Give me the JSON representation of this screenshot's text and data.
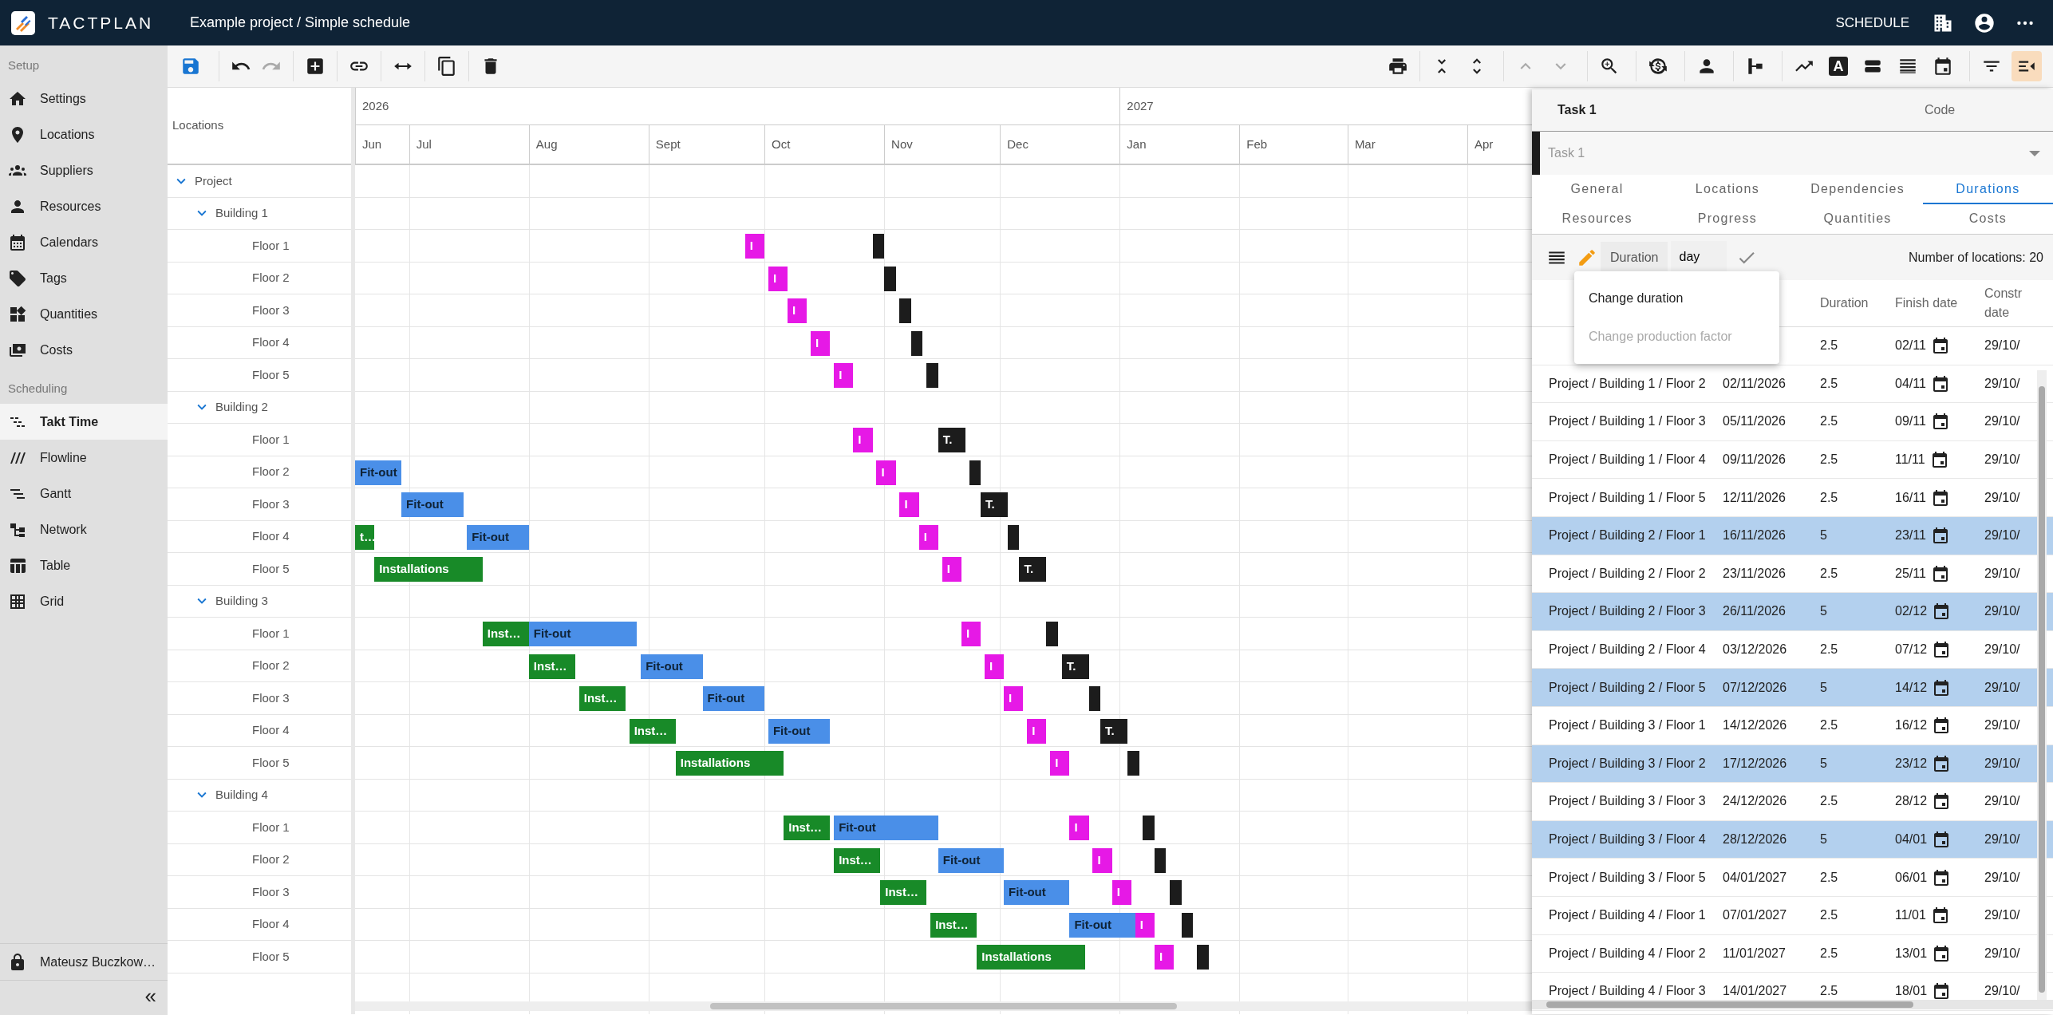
{
  "app": {
    "logo": "TACTPLAN",
    "breadcrumb": "Example project / Simple schedule",
    "mode": "SCHEDULE"
  },
  "sidebar": {
    "sections": [
      {
        "title": "Setup",
        "items": [
          {
            "label": "Settings",
            "selected": false
          },
          {
            "label": "Locations",
            "selected": false
          },
          {
            "label": "Suppliers",
            "selected": false
          },
          {
            "label": "Resources",
            "selected": false
          },
          {
            "label": "Calendars",
            "selected": false
          },
          {
            "label": "Tags",
            "selected": false
          },
          {
            "label": "Quantities",
            "selected": false
          },
          {
            "label": "Costs",
            "selected": false
          }
        ]
      },
      {
        "title": "Scheduling",
        "items": [
          {
            "label": "Takt Time",
            "selected": true
          },
          {
            "label": "Flowline",
            "selected": false
          },
          {
            "label": "Gantt",
            "selected": false
          },
          {
            "label": "Network",
            "selected": false
          },
          {
            "label": "Table",
            "selected": false
          },
          {
            "label": "Grid",
            "selected": false
          }
        ]
      }
    ],
    "user": "Mateusz Buczkow…",
    "collapse": "«"
  },
  "toolbar": {
    "left": [
      {
        "disabled": false
      },
      {
        "disabled": false
      },
      {
        "disabled": true
      },
      {
        "disabled": false
      },
      {
        "disabled": false
      },
      {
        "disabled": false
      },
      {
        "disabled": false
      },
      {
        "disabled": false
      }
    ],
    "right": [
      {
        "disabled": false,
        "selected": false
      },
      {
        "disabled": false,
        "selected": false
      },
      {
        "disabled": false,
        "selected": false
      },
      {
        "disabled": true,
        "selected": false
      },
      {
        "disabled": true,
        "selected": false
      },
      {
        "disabled": false,
        "selected": false
      },
      {
        "disabled": false,
        "selected": false
      },
      {
        "disabled": false,
        "selected": false
      },
      {
        "disabled": false,
        "selected": false
      },
      {
        "disabled": false,
        "selected": false
      },
      {
        "disabled": false,
        "selected": false,
        "label": "A"
      },
      {
        "disabled": false,
        "selected": false
      },
      {
        "disabled": false,
        "selected": false
      },
      {
        "disabled": false,
        "selected": false
      },
      {
        "disabled": false,
        "selected": false
      },
      {
        "disabled": false,
        "selected": true
      }
    ]
  },
  "gantt": {
    "header": "Locations",
    "years": [
      "2026",
      "2027"
    ],
    "months": [
      "Jun",
      "Jul",
      "Aug",
      "Sept",
      "Oct",
      "Nov",
      "Dec",
      "Jan",
      "Feb",
      "Mar",
      "Apr"
    ],
    "locations": [
      {
        "label": "Project",
        "expanded": true,
        "children": [
          {
            "label": "Building 1",
            "expanded": true,
            "children": [
              {
                "label": "Floor 1",
                "bars": [
                  {
                    "label": "I",
                    "color": "#e619e6"
                  },
                  {
                    "color": "#1c1c1c"
                  }
                ]
              },
              {
                "label": "Floor 2",
                "bars": [
                  {
                    "label": "I",
                    "color": "#e619e6"
                  },
                  {
                    "color": "#1c1c1c"
                  }
                ]
              },
              {
                "label": "Floor 3",
                "bars": [
                  {
                    "label": "I",
                    "color": "#e619e6"
                  },
                  {
                    "color": "#1c1c1c"
                  }
                ]
              },
              {
                "label": "Floor 4",
                "bars": [
                  {
                    "label": "I",
                    "color": "#e619e6"
                  },
                  {
                    "color": "#1c1c1c"
                  }
                ]
              },
              {
                "label": "Floor 5",
                "bars": [
                  {
                    "label": "I",
                    "color": "#e619e6"
                  },
                  {
                    "color": "#1c1c1c"
                  }
                ]
              }
            ]
          },
          {
            "label": "Building 2",
            "expanded": true,
            "children": [
              {
                "label": "Floor 1",
                "bars": [
                  {
                    "label": "I",
                    "color": "#e619e6"
                  },
                  {
                    "label": "T.",
                    "color": "#1c1c1c"
                  }
                ]
              },
              {
                "label": "Floor 2",
                "bars": [
                  {
                    "label": "Fit-out",
                    "color": "#4a8fe8"
                  },
                  {
                    "label": "I",
                    "color": "#e619e6"
                  },
                  {
                    "color": "#1c1c1c"
                  }
                ]
              },
              {
                "label": "Floor 3",
                "bars": [
                  {
                    "label": "Fit-out",
                    "color": "#4a8fe8"
                  },
                  {
                    "label": "I",
                    "color": "#e619e6"
                  },
                  {
                    "label": "T.",
                    "color": "#1c1c1c"
                  }
                ]
              },
              {
                "label": "Floor 4",
                "bars": [
                  {
                    "label": "t…",
                    "color": "#188a28"
                  },
                  {
                    "label": "Fit-out",
                    "color": "#4a8fe8"
                  },
                  {
                    "label": "I",
                    "color": "#e619e6"
                  },
                  {
                    "color": "#1c1c1c"
                  }
                ]
              },
              {
                "label": "Floor 5",
                "bars": [
                  {
                    "label": "Installations",
                    "color": "#188a28"
                  },
                  {
                    "label": "I",
                    "color": "#e619e6"
                  },
                  {
                    "label": "T.",
                    "color": "#1c1c1c"
                  }
                ]
              }
            ]
          },
          {
            "label": "Building 3",
            "expanded": true,
            "children": [
              {
                "label": "Floor 1",
                "bars": [
                  {
                    "label": "Inst…",
                    "color": "#188a28"
                  },
                  {
                    "label": "Fit-out",
                    "color": "#4a8fe8"
                  },
                  {
                    "label": "I",
                    "color": "#e619e6"
                  },
                  {
                    "color": "#1c1c1c"
                  }
                ]
              },
              {
                "label": "Floor 2",
                "bars": [
                  {
                    "label": "Inst…",
                    "color": "#188a28"
                  },
                  {
                    "label": "Fit-out",
                    "color": "#4a8fe8"
                  },
                  {
                    "label": "I",
                    "color": "#e619e6"
                  },
                  {
                    "label": "T.",
                    "color": "#1c1c1c"
                  }
                ]
              },
              {
                "label": "Floor 3",
                "bars": [
                  {
                    "label": "Inst…",
                    "color": "#188a28"
                  },
                  {
                    "label": "Fit-out",
                    "color": "#4a8fe8"
                  },
                  {
                    "label": "I",
                    "color": "#e619e6"
                  },
                  {
                    "color": "#1c1c1c"
                  }
                ]
              },
              {
                "label": "Floor 4",
                "bars": [
                  {
                    "label": "Inst…",
                    "color": "#188a28"
                  },
                  {
                    "label": "Fit-out",
                    "color": "#4a8fe8"
                  },
                  {
                    "label": "I",
                    "color": "#e619e6"
                  },
                  {
                    "label": "T.",
                    "color": "#1c1c1c"
                  }
                ]
              },
              {
                "label": "Floor 5",
                "bars": [
                  {
                    "label": "Installations",
                    "color": "#188a28"
                  },
                  {
                    "label": "I",
                    "color": "#e619e6"
                  },
                  {
                    "color": "#1c1c1c"
                  }
                ]
              }
            ]
          },
          {
            "label": "Building 4",
            "expanded": true,
            "children": [
              {
                "label": "Floor 1",
                "bars": [
                  {
                    "label": "Inst…",
                    "color": "#188a28"
                  },
                  {
                    "label": "Fit-out",
                    "color": "#4a8fe8"
                  },
                  {
                    "label": "I",
                    "color": "#e619e6"
                  },
                  {
                    "color": "#1c1c1c"
                  }
                ]
              },
              {
                "label": "Floor 2",
                "bars": [
                  {
                    "label": "Inst…",
                    "color": "#188a28"
                  },
                  {
                    "label": "Fit-out",
                    "color": "#4a8fe8"
                  },
                  {
                    "label": "I",
                    "color": "#e619e6"
                  },
                  {
                    "color": "#1c1c1c"
                  }
                ]
              },
              {
                "label": "Floor 3",
                "bars": [
                  {
                    "label": "Inst…",
                    "color": "#188a28"
                  },
                  {
                    "label": "Fit-out",
                    "color": "#4a8fe8"
                  },
                  {
                    "label": "I",
                    "color": "#e619e6"
                  },
                  {
                    "color": "#1c1c1c"
                  }
                ]
              },
              {
                "label": "Floor 4",
                "bars": [
                  {
                    "label": "Inst…",
                    "color": "#188a28"
                  },
                  {
                    "label": "Fit-out",
                    "color": "#4a8fe8"
                  },
                  {
                    "label": "I",
                    "color": "#e619e6"
                  },
                  {
                    "color": "#1c1c1c"
                  }
                ]
              },
              {
                "label": "Floor 5",
                "bars": [
                  {
                    "label": "Installations",
                    "color": "#188a28"
                  },
                  {
                    "label": "I",
                    "color": "#e619e6"
                  },
                  {
                    "color": "#1c1c1c"
                  }
                ]
              }
            ]
          }
        ]
      }
    ]
  },
  "task_panel": {
    "title": "Task 1",
    "code_label": "Code",
    "task_select": {
      "value": "Task 1",
      "color": "#1c1c1c"
    },
    "tabs": [
      {
        "label": "General",
        "selected": false
      },
      {
        "label": "Locations",
        "selected": false
      },
      {
        "label": "Dependencies",
        "selected": false
      },
      {
        "label": "Durations",
        "selected": true
      },
      {
        "label": "Resources",
        "selected": false
      },
      {
        "label": "Progress",
        "selected": false
      },
      {
        "label": "Quantities",
        "selected": false
      },
      {
        "label": "Costs",
        "selected": false
      }
    ],
    "mode": "Duration",
    "unit": "day",
    "count": "Number of locations: 20",
    "menu": [
      {
        "label": "Change duration",
        "disabled": false
      },
      {
        "label": "Change production factor",
        "disabled": true
      }
    ],
    "columns": [
      "Duration",
      "Finish date",
      "Constr date"
    ],
    "rows": [
      {
        "duration": "2.5",
        "finish": "02/11",
        "constr": "29/10/",
        "selected": false
      },
      {
        "item": "Project / Building 1 / Floor 2",
        "start": "02/11/2026",
        "duration": "2.5",
        "finish": "04/11",
        "constr": "29/10/",
        "selected": false
      },
      {
        "item": "Project / Building 1 / Floor 3",
        "start": "05/11/2026",
        "duration": "2.5",
        "finish": "09/11",
        "constr": "29/10/",
        "selected": false
      },
      {
        "item": "Project / Building 1 / Floor 4",
        "start": "09/11/2026",
        "duration": "2.5",
        "finish": "11/11",
        "constr": "29/10/",
        "selected": false
      },
      {
        "item": "Project / Building 1 / Floor 5",
        "start": "12/11/2026",
        "duration": "2.5",
        "finish": "16/11",
        "constr": "29/10/",
        "selected": false
      },
      {
        "item": "Project / Building 2 / Floor 1",
        "start": "16/11/2026",
        "duration": "5",
        "finish": "23/11",
        "constr": "29/10/",
        "selected": true
      },
      {
        "item": "Project / Building 2 / Floor 2",
        "start": "23/11/2026",
        "duration": "2.5",
        "finish": "25/11",
        "constr": "29/10/",
        "selected": false
      },
      {
        "item": "Project / Building 2 / Floor 3",
        "start": "26/11/2026",
        "duration": "5",
        "finish": "02/12",
        "constr": "29/10/",
        "selected": true
      },
      {
        "item": "Project / Building 2 / Floor 4",
        "start": "03/12/2026",
        "duration": "2.5",
        "finish": "07/12",
        "constr": "29/10/",
        "selected": false
      },
      {
        "item": "Project / Building 2 / Floor 5",
        "start": "07/12/2026",
        "duration": "5",
        "finish": "14/12",
        "constr": "29/10/",
        "selected": true
      },
      {
        "item": "Project / Building 3 / Floor 1",
        "start": "14/12/2026",
        "duration": "2.5",
        "finish": "16/12",
        "constr": "29/10/",
        "selected": false
      },
      {
        "item": "Project / Building 3 / Floor 2",
        "start": "17/12/2026",
        "duration": "5",
        "finish": "23/12",
        "constr": "29/10/",
        "selected": true
      },
      {
        "item": "Project / Building 3 / Floor 3",
        "start": "24/12/2026",
        "duration": "2.5",
        "finish": "28/12",
        "constr": "29/10/",
        "selected": false
      },
      {
        "item": "Project / Building 3 / Floor 4",
        "start": "28/12/2026",
        "duration": "5",
        "finish": "04/01",
        "constr": "29/10/",
        "selected": true
      },
      {
        "item": "Project / Building 3 / Floor 5",
        "start": "04/01/2027",
        "duration": "2.5",
        "finish": "06/01",
        "constr": "29/10/",
        "selected": false
      },
      {
        "item": "Project / Building 4 / Floor 1",
        "start": "07/01/2027",
        "duration": "2.5",
        "finish": "11/01",
        "constr": "29/10/",
        "selected": false
      },
      {
        "item": "Project / Building 4 / Floor 2",
        "start": "11/01/2027",
        "duration": "2.5",
        "finish": "13/01",
        "constr": "29/10/",
        "selected": false
      },
      {
        "item": "Project / Building 4 / Floor 3",
        "start": "14/01/2027",
        "duration": "2.5",
        "finish": "18/01",
        "constr": "29/10/",
        "selected": false
      }
    ]
  }
}
